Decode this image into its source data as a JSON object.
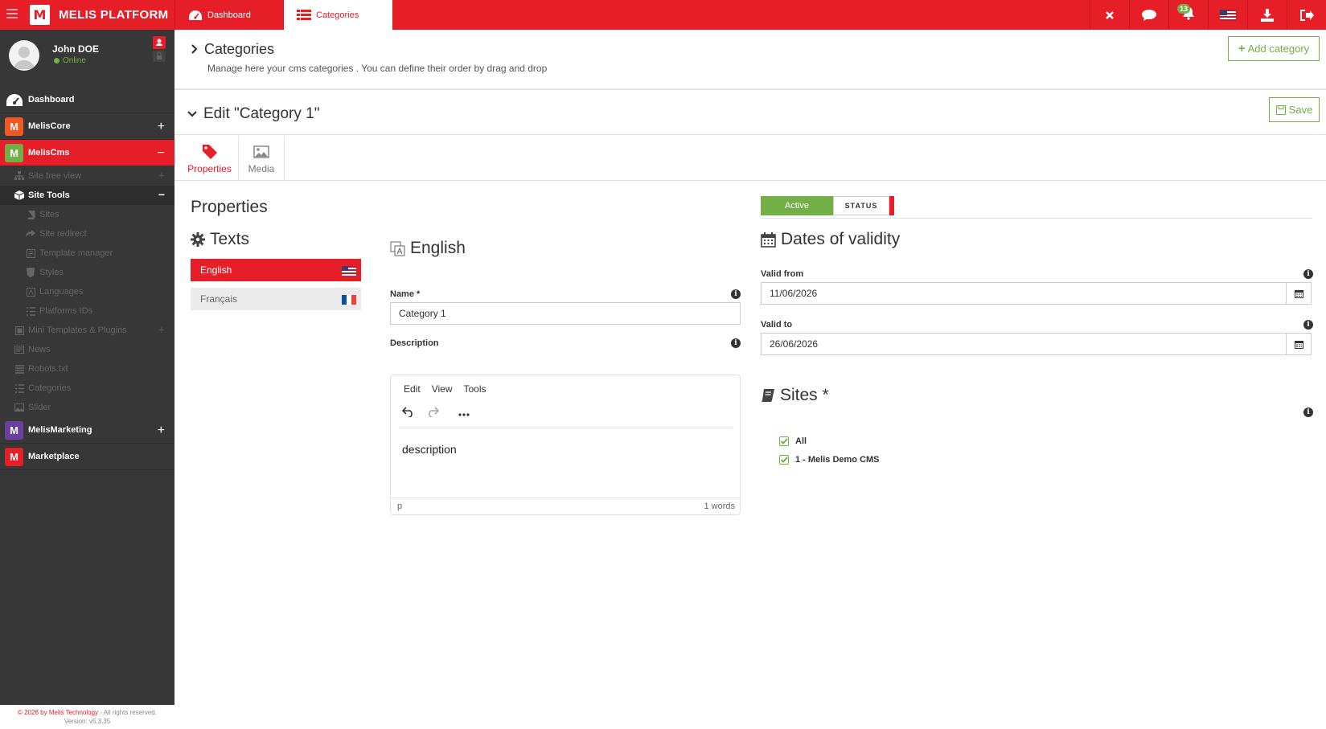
{
  "topbar": {
    "brand": "MELIS PLATFORM",
    "logo_glyph": "M",
    "tabs": [
      {
        "label": "Dashboard",
        "icon": "dashboard-icon"
      },
      {
        "label": "Categories",
        "icon": "list-icon"
      }
    ],
    "notification_count": "13",
    "icons": [
      "close-icon",
      "chat-icon",
      "bell-icon",
      "us-flag-icon",
      "download-icon",
      "logout-icon"
    ]
  },
  "user": {
    "name": "John DOE",
    "status": "Online"
  },
  "sidebar": {
    "items": [
      {
        "label": "Dashboard",
        "icon_glyph": ""
      },
      {
        "label": "MelisCore",
        "icon_glyph": "M",
        "color": "#f05a22"
      },
      {
        "label": "MelisCms",
        "icon_glyph": "M",
        "color": "#72af46"
      },
      {
        "label": "MelisMarketing",
        "icon_glyph": "M",
        "color": "#6b3fa0"
      },
      {
        "label": "Marketplace",
        "icon_glyph": "M",
        "color": "#e61e27"
      }
    ],
    "sub": {
      "site_tree": "Site tree view",
      "site_tools": "Site Tools",
      "sites": "Sites",
      "site_redirect": "Site redirect",
      "template_manager": "Template manager",
      "styles": "Styles",
      "languages": "Languages",
      "platform_ids": "Platforms IDs",
      "mini_templates": "Mini Templates & Plugins",
      "news": "News",
      "robots": "Robots.txt",
      "categories": "Categories",
      "slider": "Slider"
    }
  },
  "footer": {
    "copyright": "© 2026 by Melis Technology",
    "rights": " - All rights reserved.",
    "version": "Version: v5.3.35"
  },
  "page": {
    "title": "Categories",
    "subtitle": "Manage here your cms categories . You can define their order by drag and drop",
    "add_button": "Add category"
  },
  "edit": {
    "title": "Edit \"Category 1\"",
    "save_button": "Save",
    "tabs": [
      {
        "label": "Properties"
      },
      {
        "label": "Media"
      }
    ]
  },
  "properties": {
    "title": "Properties",
    "status_value": "Active",
    "status_label": "STATUS",
    "texts_title": "Texts",
    "languages": [
      {
        "label": "English"
      },
      {
        "label": "Français"
      }
    ],
    "lang_title": "English",
    "name_label": "Name *",
    "name_value": "Category 1",
    "description_label": "Description",
    "editor_menu": [
      "Edit",
      "View",
      "Tools"
    ],
    "editor_content": "description",
    "editor_path": "p",
    "editor_words": "1 words",
    "dates_title": "Dates of validity",
    "valid_from_label": "Valid from",
    "valid_from_value": "11/06/2026",
    "valid_to_label": "Valid to",
    "valid_to_value": "26/06/2026",
    "sites_title": "Sites *",
    "sites": [
      "All",
      "1 - Melis Demo CMS"
    ]
  },
  "colors": {
    "brand_red": "#e61e27",
    "green": "#72af46",
    "sidebar_bg": "#373737"
  }
}
